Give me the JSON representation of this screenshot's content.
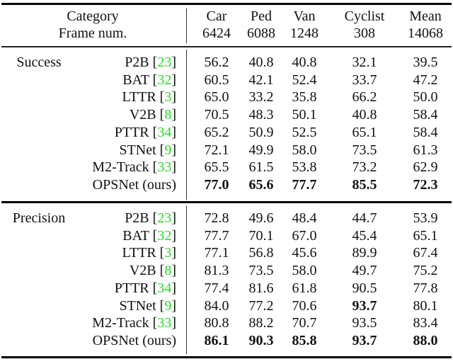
{
  "table": {
    "header": {
      "row1_label": "Category",
      "row2_label": "Frame num.",
      "columns": [
        {
          "name": "Car",
          "frames": "6424"
        },
        {
          "name": "Ped",
          "frames": "6088"
        },
        {
          "name": "Van",
          "frames": "1248"
        },
        {
          "name": "Cyclist",
          "frames": "308"
        },
        {
          "name": "Mean",
          "frames": "14068"
        }
      ]
    },
    "colors": {
      "citation": "#22dd22",
      "text": "#111111"
    },
    "sections": [
      {
        "label": "Success",
        "rows": [
          {
            "method": "P2B",
            "cite": "23",
            "values": [
              "56.2",
              "40.8",
              "40.8",
              "32.1",
              "39.5"
            ],
            "bold": [
              false,
              false,
              false,
              false,
              false
            ]
          },
          {
            "method": "BAT",
            "cite": "32",
            "values": [
              "60.5",
              "42.1",
              "52.4",
              "33.7",
              "47.2"
            ],
            "bold": [
              false,
              false,
              false,
              false,
              false
            ]
          },
          {
            "method": "LTTR",
            "cite": "3",
            "values": [
              "65.0",
              "33.2",
              "35.8",
              "66.2",
              "50.0"
            ],
            "bold": [
              false,
              false,
              false,
              false,
              false
            ]
          },
          {
            "method": "V2B",
            "cite": "8",
            "values": [
              "70.5",
              "48.3",
              "50.1",
              "40.8",
              "58.4"
            ],
            "bold": [
              false,
              false,
              false,
              false,
              false
            ]
          },
          {
            "method": "PTTR",
            "cite": "34",
            "values": [
              "65.2",
              "50.9",
              "52.5",
              "65.1",
              "58.4"
            ],
            "bold": [
              false,
              false,
              false,
              false,
              false
            ]
          },
          {
            "method": "STNet",
            "cite": "9",
            "values": [
              "72.1",
              "49.9",
              "58.0",
              "73.5",
              "61.3"
            ],
            "bold": [
              false,
              false,
              false,
              false,
              false
            ]
          },
          {
            "method": "M2-Track",
            "cite": "33",
            "values": [
              "65.5",
              "61.5",
              "53.8",
              "73.2",
              "62.9"
            ],
            "bold": [
              false,
              false,
              false,
              false,
              false
            ]
          },
          {
            "method": "OPSNet (ours)",
            "cite": null,
            "values": [
              "77.0",
              "65.6",
              "77.7",
              "85.5",
              "72.3"
            ],
            "bold": [
              true,
              true,
              true,
              true,
              true
            ]
          }
        ]
      },
      {
        "label": "Precision",
        "rows": [
          {
            "method": "P2B",
            "cite": "23",
            "values": [
              "72.8",
              "49.6",
              "48.4",
              "44.7",
              "53.9"
            ],
            "bold": [
              false,
              false,
              false,
              false,
              false
            ]
          },
          {
            "method": "BAT",
            "cite": "32",
            "values": [
              "77.7",
              "70.1",
              "67.0",
              "45.4",
              "65.1"
            ],
            "bold": [
              false,
              false,
              false,
              false,
              false
            ]
          },
          {
            "method": "LTTR",
            "cite": "3",
            "values": [
              "77.1",
              "56.8",
              "45.6",
              "89.9",
              "67.4"
            ],
            "bold": [
              false,
              false,
              false,
              false,
              false
            ]
          },
          {
            "method": "V2B",
            "cite": "8",
            "values": [
              "81.3",
              "73.5",
              "58.0",
              "49.7",
              "75.2"
            ],
            "bold": [
              false,
              false,
              false,
              false,
              false
            ]
          },
          {
            "method": "PTTR",
            "cite": "34",
            "values": [
              "77.4",
              "81.6",
              "61.8",
              "90.5",
              "77.8"
            ],
            "bold": [
              false,
              false,
              false,
              false,
              false
            ]
          },
          {
            "method": "STNet",
            "cite": "9",
            "values": [
              "84.0",
              "77.2",
              "70.6",
              "93.7",
              "80.1"
            ],
            "bold": [
              false,
              false,
              false,
              true,
              false
            ]
          },
          {
            "method": "M2-Track",
            "cite": "33",
            "values": [
              "80.8",
              "88.2",
              "70.7",
              "93.5",
              "83.4"
            ],
            "bold": [
              false,
              false,
              false,
              false,
              false
            ]
          },
          {
            "method": "OPSNet (ours)",
            "cite": null,
            "values": [
              "86.1",
              "90.3",
              "85.8",
              "93.7",
              "88.0"
            ],
            "bold": [
              true,
              true,
              true,
              true,
              true
            ]
          }
        ]
      }
    ]
  }
}
